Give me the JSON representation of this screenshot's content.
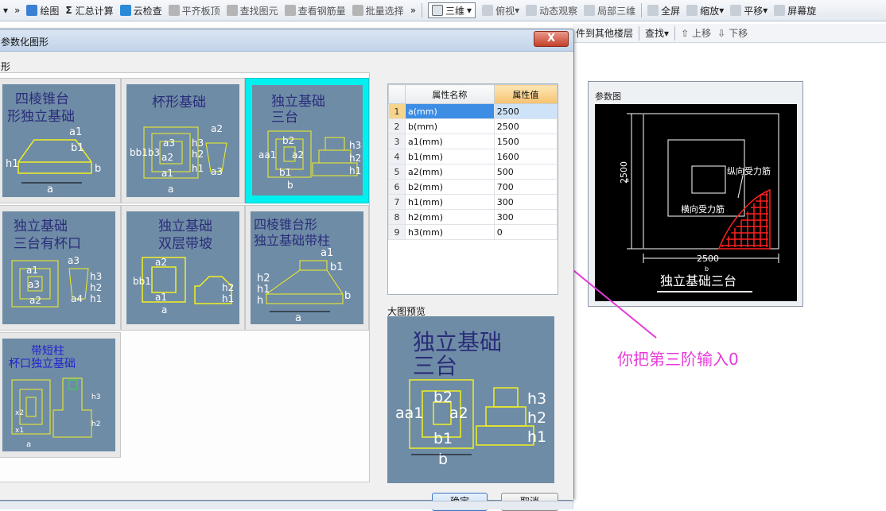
{
  "toolbar": {
    "items": [
      {
        "label": "绘图",
        "icon": "draw-icon",
        "color": "#3a7fd4"
      },
      {
        "label": "汇总计算",
        "icon": "sigma-icon",
        "color": "#333333"
      },
      {
        "label": "云检查",
        "icon": "cloud-check-icon",
        "color": "#2a8ad8"
      },
      {
        "label": "平齐板顶",
        "icon": "align-slab-icon",
        "color": "#888888"
      },
      {
        "label": "查找图元",
        "icon": "find-element-icon",
        "color": "#888888"
      },
      {
        "label": "查看钢筋量",
        "icon": "rebar-view-icon",
        "color": "#888888"
      },
      {
        "label": "批量选择",
        "icon": "batch-select-icon",
        "color": "#888888"
      }
    ],
    "view_mode": "三维",
    "right_items": [
      {
        "label": "俯视",
        "icon": "top-view-icon"
      },
      {
        "label": "动态观察",
        "icon": "orbit-icon"
      },
      {
        "label": "局部三维",
        "icon": "local-3d-icon"
      },
      {
        "label": "全屏",
        "icon": "fullscreen-icon"
      },
      {
        "label": "缩放",
        "icon": "zoom-icon"
      },
      {
        "label": "平移",
        "icon": "pan-icon"
      },
      {
        "label": "屏幕旋",
        "icon": "rotate-icon"
      }
    ]
  },
  "toolbar2": {
    "copy_floor": "件到其他楼层",
    "find": "查找",
    "move_up": "上移",
    "move_down": "下移"
  },
  "dialog": {
    "title": "参数化图形",
    "close": "X",
    "group_label": "形",
    "ok": "确定",
    "cancel": "取消",
    "preview_label": "大图预览"
  },
  "shapes": [
    {
      "name": "四棱锥台形独立基础",
      "line1": "四棱锥台",
      "line2": "形独立基础"
    },
    {
      "name": "杯形基础",
      "line1": "杯形基础",
      "line2": ""
    },
    {
      "name": "独立基础三台",
      "line1": "独立基础",
      "line2": "三台",
      "selected": true
    },
    {
      "name": "独立基础三台有杯口",
      "line1": "独立基础",
      "line2": "三台有杯口"
    },
    {
      "name": "独立基础双层带坡",
      "line1": "独立基础",
      "line2": "双层带坡"
    },
    {
      "name": "四棱锥台形独立基础带柱",
      "line1": "四棱锥台形",
      "line2": "独立基础带柱"
    },
    {
      "name": "带短柱杯口独立基础",
      "line1": "带短柱",
      "line2": "杯口独立基础"
    }
  ],
  "table": {
    "headers": [
      "属性名称",
      "属性值"
    ],
    "rows": [
      {
        "idx": "1",
        "name": "a(mm)",
        "value": "2500"
      },
      {
        "idx": "2",
        "name": "b(mm)",
        "value": "2500"
      },
      {
        "idx": "3",
        "name": "a1(mm)",
        "value": "1500"
      },
      {
        "idx": "4",
        "name": "b1(mm)",
        "value": "1600"
      },
      {
        "idx": "5",
        "name": "a2(mm)",
        "value": "500"
      },
      {
        "idx": "6",
        "name": "b2(mm)",
        "value": "700"
      },
      {
        "idx": "7",
        "name": "h1(mm)",
        "value": "300"
      },
      {
        "idx": "8",
        "name": "h2(mm)",
        "value": "300"
      },
      {
        "idx": "9",
        "name": "h3(mm)",
        "value": "0"
      }
    ]
  },
  "preview": {
    "line1": "独立基础",
    "line2": "三台"
  },
  "param_panel": {
    "label": "参数图",
    "dim_vertical": "2500",
    "dim_vertical_sub": "a",
    "dim_horizontal": "2500",
    "dim_horizontal_sub": "b",
    "long_rebar": "纵向受力筋",
    "trans_rebar": "横向受力筋",
    "caption": "独立基础三台"
  },
  "annotation": "你把第三阶输入0",
  "colors": {
    "annotation": "#e63ad8",
    "tile_bg": "#6f8ca6",
    "drawing_line": "#f0f020",
    "drawing_text": "#2a2d7a"
  }
}
